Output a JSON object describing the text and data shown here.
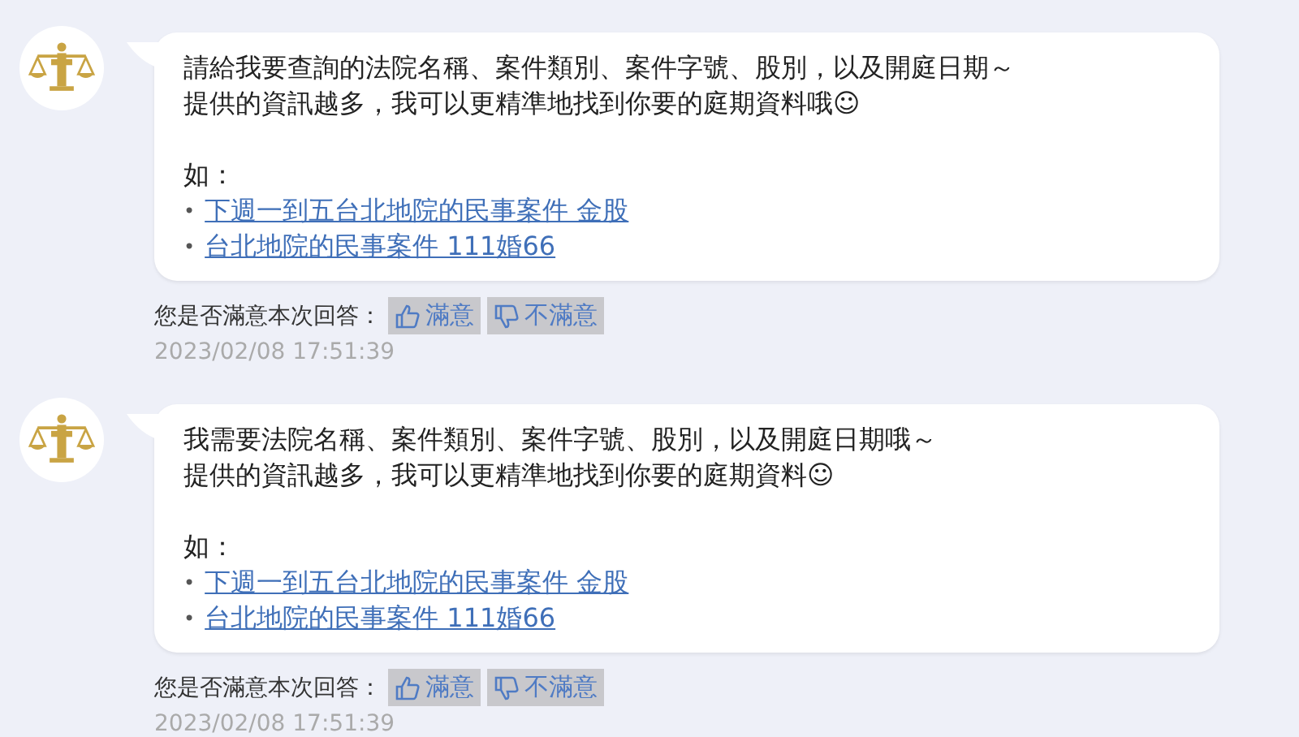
{
  "messages": [
    {
      "lines": [
        "請給我要查詢的法院名稱、案件類別、案件字號、股別，以及開庭日期～",
        "提供的資訊越多，我可以更精準地找到你要的庭期資料哦☺"
      ],
      "example_label": "如：",
      "examples": [
        {
          "bullet": "•",
          "link": "下週一到五台北地院的民事案件 金股"
        },
        {
          "bullet": "•",
          "link": "台北地院的民事案件 111婚66"
        }
      ],
      "feedback_prompt": "您是否滿意本次回答：",
      "feedback_buttons": [
        {
          "kind": "up",
          "label": "滿意"
        },
        {
          "kind": "down",
          "label": "不滿意"
        }
      ],
      "timestamp": "2023/02/08 17:51:39"
    },
    {
      "lines": [
        "我需要法院名稱、案件類別、案件字號、股別，以及開庭日期哦～",
        "提供的資訊越多，我可以更精準地找到你要的庭期資料☺"
      ],
      "example_label": "如：",
      "examples": [
        {
          "bullet": "•",
          "link": "下週一到五台北地院的民事案件 金股"
        },
        {
          "bullet": "•",
          "link": "台北地院的民事案件 111婚66"
        }
      ],
      "feedback_prompt": "您是否滿意本次回答：",
      "feedback_buttons": [
        {
          "kind": "up",
          "label": "滿意"
        },
        {
          "kind": "down",
          "label": "不滿意"
        }
      ],
      "timestamp": "2023/02/08 17:51:39"
    }
  ]
}
